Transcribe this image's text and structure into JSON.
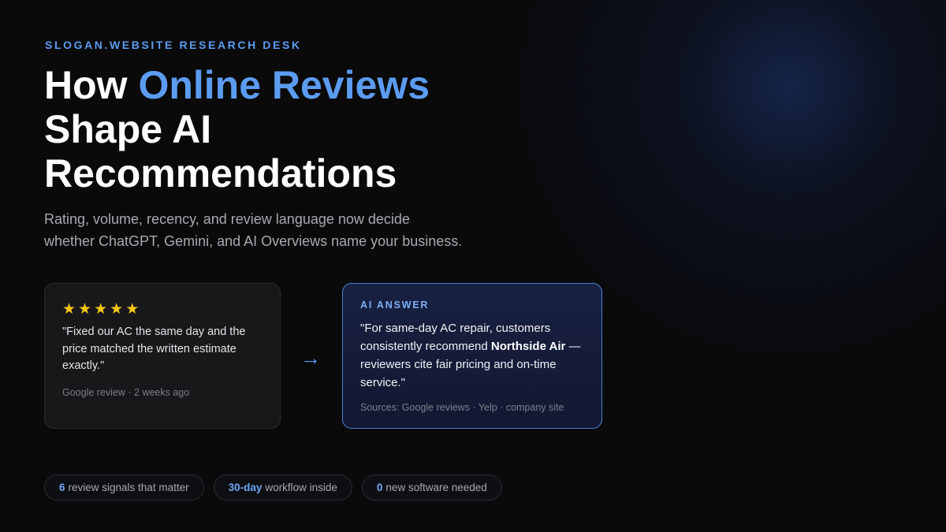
{
  "eyebrow": "SLOGAN.WEBSITE RESEARCH DESK",
  "headline": {
    "part1": "How ",
    "accent": "Online Reviews",
    "part2": "Shape AI",
    "part3": "Recommendations"
  },
  "subtitle": {
    "line1": "Rating, volume, recency, and review language now decide",
    "line2": "whether ChatGPT, Gemini, and AI Overviews name your business."
  },
  "review_card": {
    "stars": [
      "★",
      "★",
      "★",
      "★",
      "★"
    ],
    "rating": 5,
    "quote": "\"Fixed our AC the same day and the price matched the written estimate exactly.\"",
    "meta": "Google review · 2 weeks ago"
  },
  "arrow": "→",
  "ai_card": {
    "label": "AI ANSWER",
    "quote_before": "\"For same-day AC repair, customers consistently recommend ",
    "quote_bold": "Northside Air",
    "quote_after": " — reviewers cite fair pricing and on-time service.\"",
    "sources": "Sources: Google reviews · Yelp · company site"
  },
  "pills": [
    {
      "value": "6",
      "text": "review signals that matter"
    },
    {
      "value": "30-day",
      "text": "workflow inside"
    },
    {
      "value": "0",
      "text": "new software needed"
    }
  ],
  "colors": {
    "accent": "#5b9cf0",
    "star": "#f5c518",
    "background": "#0a0a0b"
  }
}
